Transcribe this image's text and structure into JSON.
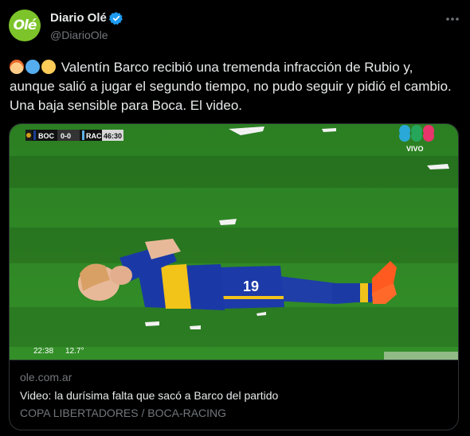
{
  "author": {
    "name": "Diario Olé",
    "handle": "@DiarioOle",
    "avatar_text": "Olé",
    "avatar_color": "#7cc42a",
    "verified_color": "#1d9bf0"
  },
  "more_icon": "more-horizontal-icon",
  "tweet": {
    "text": "Valentín Barco recibió una tremenda infracción de Rubio y, aunque salió a jugar el segundo tiempo, no pudo seguir y pidió el cambio. Una baja sensible para Boca. El video.",
    "emojis": [
      "boy-emoji",
      "blue-circle-emoji",
      "yellow-circle-emoji"
    ]
  },
  "media": {
    "scoreboard": {
      "home": "BOC",
      "score": "0-0",
      "away": "RAC",
      "time": "46:30"
    },
    "broadcaster": "VIVO",
    "clock": "22:38",
    "temperature": "12.7°",
    "jersey_number": "19",
    "pitch_color": "#2f8a25"
  },
  "link_card": {
    "domain": "ole.com.ar",
    "title": "Video: la durísima falta que sacó a Barco del partido",
    "description": "COPA LIBERTADORES / BOCA-RACING"
  }
}
